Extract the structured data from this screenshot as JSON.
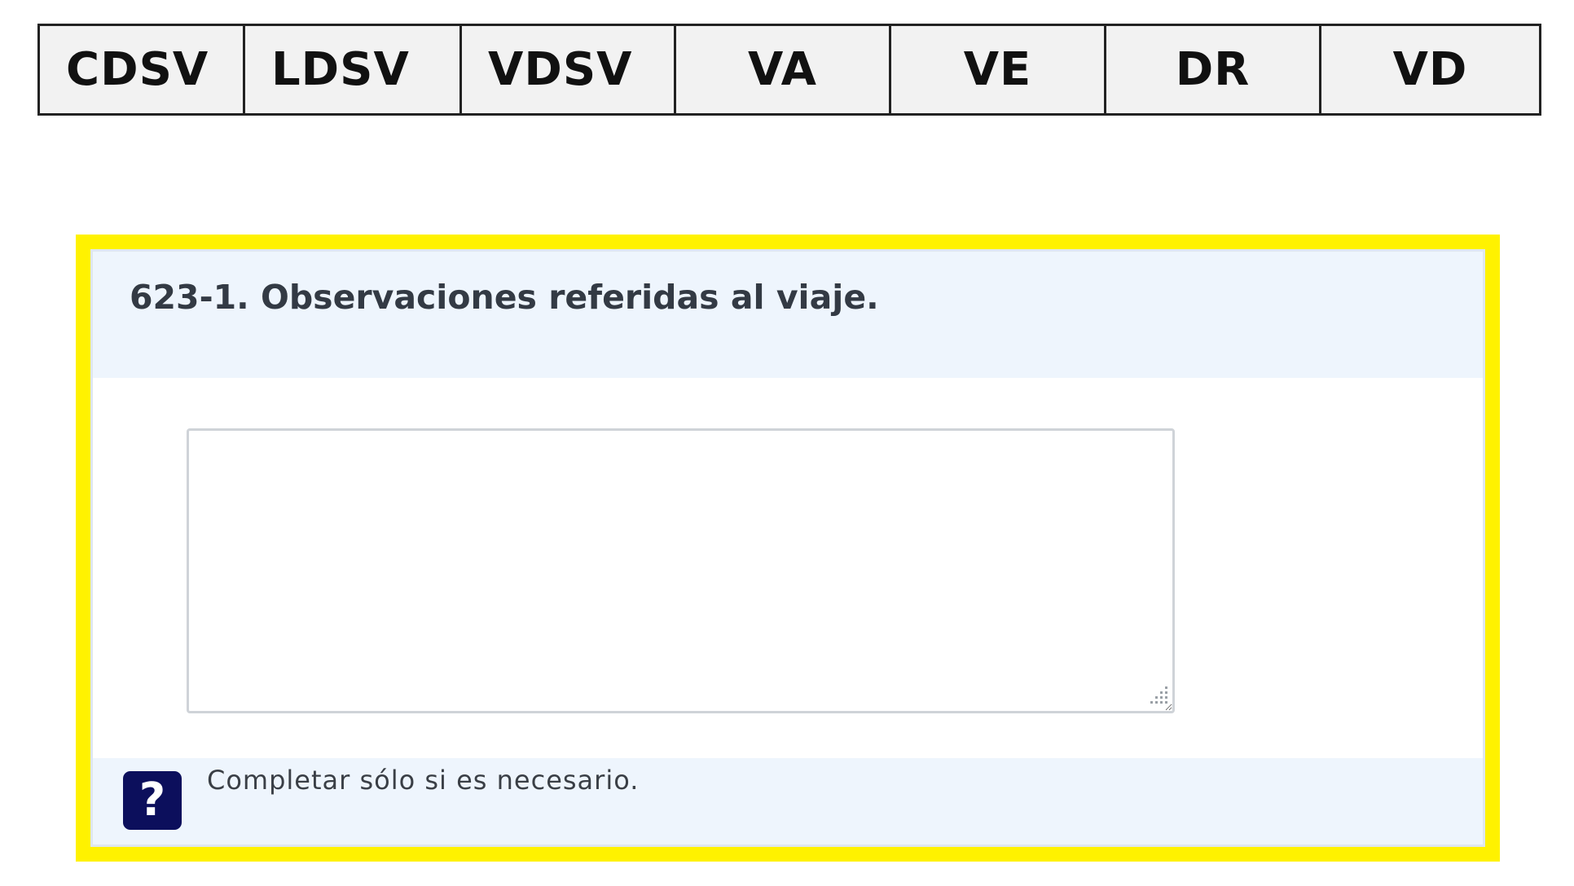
{
  "tabs": [
    {
      "label": "CDSV"
    },
    {
      "label": "LDSV"
    },
    {
      "label": "VDSV"
    },
    {
      "label": "VA"
    },
    {
      "label": "VE"
    },
    {
      "label": "DR"
    },
    {
      "label": "VD"
    }
  ],
  "question": {
    "title": "623-1. Observaciones referidas al viaje.",
    "answer_value": "",
    "help_icon_glyph": "?",
    "help_text": "Completar sólo si es necesario."
  },
  "colors": {
    "highlight": "#fff200",
    "header_bg": "#eef5fd",
    "help_icon_bg": "#0c0f5c"
  },
  "icons": {
    "help": "question-mark-icon",
    "resize": "resize-grip-icon"
  }
}
